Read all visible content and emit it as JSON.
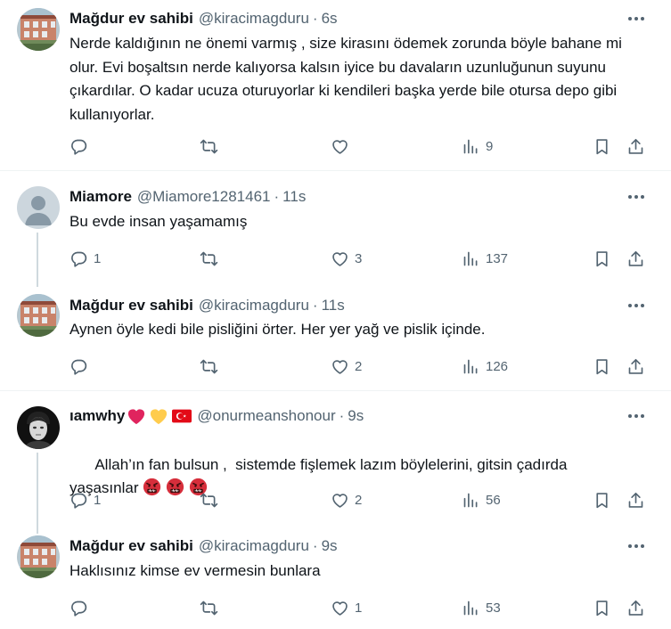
{
  "tweets": [
    {
      "name": "Mağdur ev sahibi",
      "handle": "@kiracimagduru",
      "time": "6s",
      "text": "Nerde kaldığının ne önemi varmış , size kirasını ödemek zorunda böyle bahane mi olur. Evi boşaltsın nerde kalıyorsa kalsın iyice bu davaların uzunluğunun suyunu çıkardılar. O kadar ucuza oturuyorlar ki kendileri başka yerde bile otursa depo gibi kullanıyorlar.",
      "replies": "",
      "retweets": "",
      "likes": "",
      "views": "9"
    },
    {
      "name": "Miamore",
      "handle": "@Miamore1281461",
      "time": "11s",
      "text": "Bu evde insan yaşamamış",
      "replies": "1",
      "retweets": "",
      "likes": "3",
      "views": "137"
    },
    {
      "name": "Mağdur ev sahibi",
      "handle": "@kiracimagduru",
      "time": "11s",
      "text": "Aynen öyle kedi bile pisliğini örter. Her yer yağ ve pislik içinde.",
      "replies": "",
      "retweets": "",
      "likes": "2",
      "views": "126"
    },
    {
      "name": "ıamwhy",
      "handle": "@onurmeanshonour",
      "time": "9s",
      "text": "Allah’ın fan bulsun ,  sistemde fişlemek lazım böylelerini, gitsin çadırda yaşasınlar",
      "replies": "1",
      "retweets": "",
      "likes": "2",
      "views": "56"
    },
    {
      "name": "Mağdur ev sahibi",
      "handle": "@kiracimagduru",
      "time": "9s",
      "text": "Haklısınız kimse ev vermesin bunlara",
      "replies": "",
      "retweets": "",
      "likes": "1",
      "views": "53"
    }
  ],
  "sep": "·",
  "colors": {
    "text": "#0f1419",
    "secondary": "#536471",
    "divider": "#eff3f4",
    "thread": "#cfd9de",
    "heart": "#e0245e",
    "gold": "#ffcc4d",
    "flag": "#e30a17"
  },
  "icons": [
    "reply-icon",
    "retweet-icon",
    "like-icon",
    "views-icon",
    "bookmark-icon",
    "share-icon",
    "more-icon",
    "red-heart-emoji",
    "yellow-heart-emoji",
    "turkey-flag-emoji",
    "angry-face-emoji"
  ]
}
